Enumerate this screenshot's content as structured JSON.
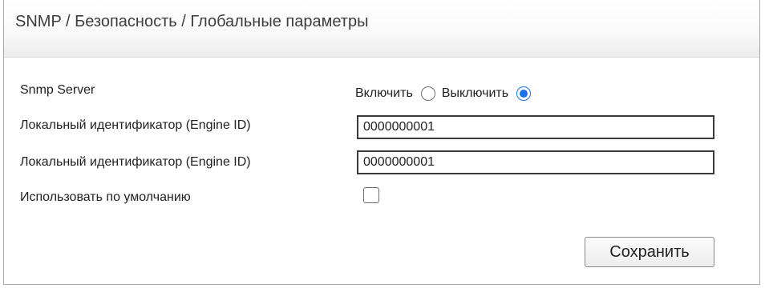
{
  "header": {
    "title": "SNMP / Безопасность / Глобальные параметры"
  },
  "form": {
    "snmp_server": {
      "label": "Snmp Server",
      "options": [
        {
          "label": "Включить",
          "checked": false
        },
        {
          "label": "Выключить",
          "checked": true
        }
      ]
    },
    "engine_id_1": {
      "label": "Локальный идентификатор (Engine ID)",
      "value": "0000000001"
    },
    "engine_id_2": {
      "label": "Локальный идентификатор (Engine ID)",
      "value": "0000000001"
    },
    "use_default": {
      "label": "Использовать по умолчанию",
      "checked": false
    },
    "save_label": "Сохранить"
  },
  "colors": {
    "accent": "#1a73e8",
    "border_dark": "#3a3a3a",
    "header_bg_bottom": "#ececec"
  }
}
